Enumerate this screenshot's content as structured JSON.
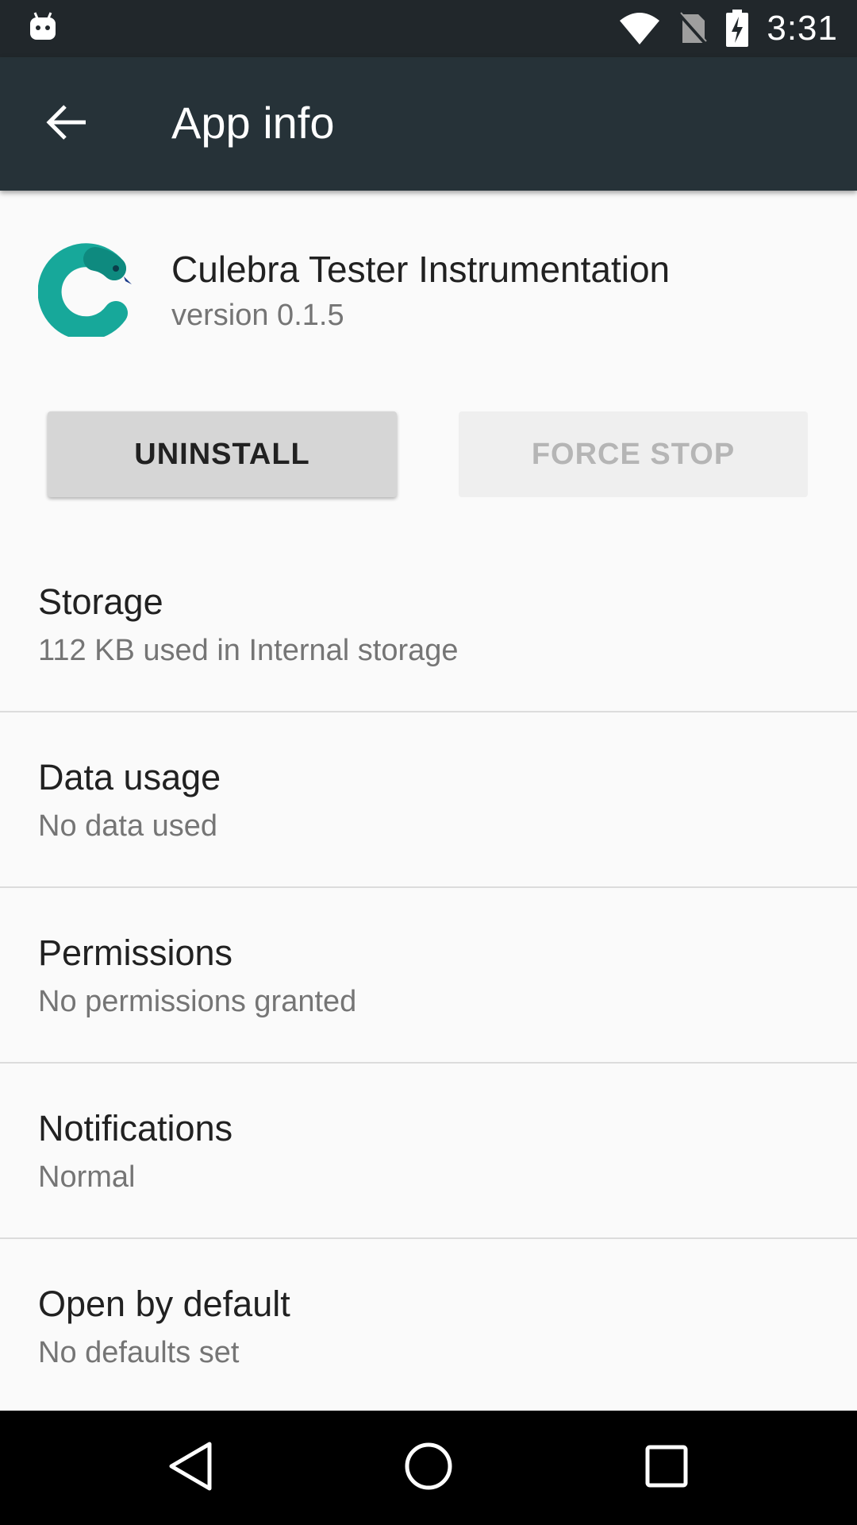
{
  "status_bar": {
    "time": "3:31",
    "icons": [
      "android-notification-icon",
      "wifi-icon",
      "no-sim-icon",
      "battery-charging-icon"
    ]
  },
  "app_bar": {
    "title": "App info",
    "back_icon": "arrow-back-icon"
  },
  "app": {
    "name": "Culebra Tester Instrumentation",
    "version": "version 0.1.5",
    "icon": "culebra-snake-icon",
    "icon_color": "#17a89a"
  },
  "buttons": {
    "uninstall": "UNINSTALL",
    "force_stop": "FORCE STOP"
  },
  "items": [
    {
      "title": "Storage",
      "subtitle": "112 KB used in Internal storage"
    },
    {
      "title": "Data usage",
      "subtitle": "No data used"
    },
    {
      "title": "Permissions",
      "subtitle": "No permissions granted"
    },
    {
      "title": "Notifications",
      "subtitle": "Normal"
    },
    {
      "title": "Open by default",
      "subtitle": "No defaults set"
    }
  ],
  "nav_bar": {
    "icons": [
      "nav-back-icon",
      "nav-home-icon",
      "nav-recents-icon"
    ]
  },
  "colors": {
    "status_bar": "#21272b",
    "app_bar": "#263238",
    "background": "#fafafa"
  }
}
